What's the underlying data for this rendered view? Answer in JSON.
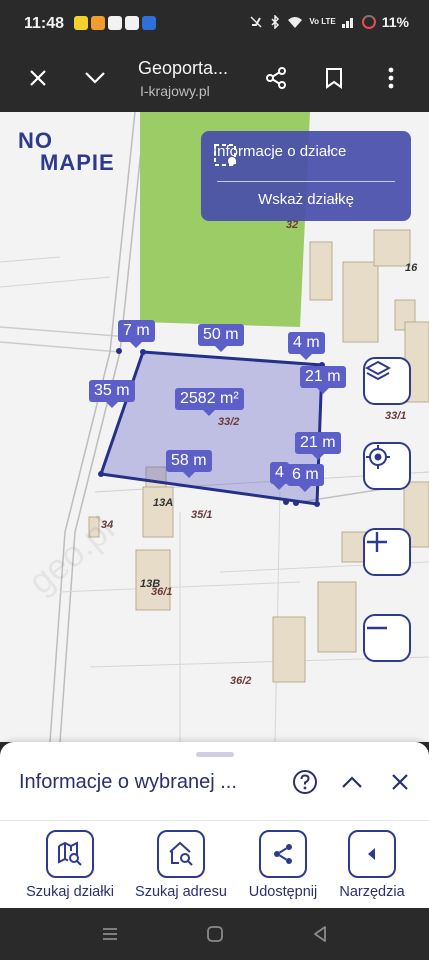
{
  "status_bar": {
    "time": "11:48",
    "battery": "11%",
    "network": "Vo LTE"
  },
  "browser": {
    "title": "Geoporta...",
    "url": "I-krajowy.pl"
  },
  "map": {
    "logo_line1": "NO",
    "logo_line2": "MAPIE",
    "info_card": {
      "title": "Informacje o działce",
      "action": "Wskaż działkę"
    },
    "dimensions": [
      "7 m",
      "50 m",
      "4 m",
      "21 m",
      "35 m",
      "2582 m²",
      "21 m",
      "58 m",
      "4",
      "6 m"
    ],
    "plot_numbers": [
      "32",
      "16",
      "33/2",
      "33/1",
      "13A",
      "35/1",
      "34",
      "13B",
      "36/1",
      "36/2"
    ],
    "watermark": "geo.pl"
  },
  "sheet": {
    "title": "Informacje o wybranej ...",
    "actions": [
      {
        "label": "Szukaj działki"
      },
      {
        "label": "Szukaj adresu"
      },
      {
        "label": "Udostępnij"
      },
      {
        "label": "Narzędzia"
      }
    ]
  },
  "colors": {
    "accent": "#2e3a8c",
    "plot_fill": "#5b5fc7",
    "green_area": "#9ccc65"
  }
}
